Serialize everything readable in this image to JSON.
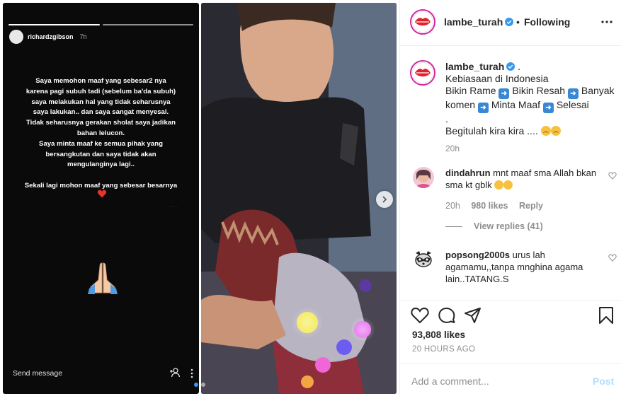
{
  "story": {
    "username": "richardzgibson",
    "time": "7h",
    "text": "Saya memohon maaf yang sebesar2 nya\nkarena pagi subuh tadi (sebelum ba'da subuh)\nsaya melakukan hal yang tidak seharusnya\nsaya lakukan.. dan saya sangat menyesal.\nTidak seharusnya gerakan sholat saya jadikan\nbahan lelucon.\nSaya minta maaf ke semua pihak yang\nbersangkutan dan saya tidak akan\nmengulanginya lagi..\n\nSekali lagi mohon maaf yang sebesar besarnya",
    "send_message": "Send message",
    "icons": {
      "heart": "red-heart-icon",
      "hands": "folded-hands-icon",
      "add_user": "add-user-icon",
      "more": "vertical-dots-icon"
    }
  },
  "header": {
    "username": "lambe_turah",
    "dot": "•",
    "follow_label": "Following"
  },
  "caption": {
    "username": "lambe_turah",
    "after_name": ".",
    "line1": "Kebiasaan di Indonesia",
    "word1": "Bikin Rame",
    "word2": "Bikin Resah",
    "word3": "Banyak",
    "word4": "komen",
    "word5": "Minta Maaf",
    "word6": "Selesai",
    "line3": ".",
    "line4": "Begitulah kira kira ....",
    "time": "20h"
  },
  "comments": [
    {
      "username": "dindahrun",
      "text": "mnt maaf sma Allah bkan sma kt gblk",
      "time": "20h",
      "likes": "980 likes",
      "reply": "Reply",
      "view_replies": "View replies (41)"
    },
    {
      "username": "popsong2000s",
      "text": "urus lah agamamu,,tanpa mnghina agama lain..TATANG.S"
    }
  ],
  "actions": {
    "likes": "93,808 likes",
    "ago": "20 HOURS AGO",
    "icons": [
      "heart-outline-icon",
      "comment-icon",
      "share-icon",
      "bookmark-icon"
    ]
  },
  "add_comment": {
    "placeholder": "Add a comment...",
    "post_label": "Post"
  },
  "colors": {
    "accent": "#3897f0",
    "post_disabled": "#b2dffc",
    "arrow_bg": "#3a87d4",
    "brand_ring": "#d6249f"
  }
}
